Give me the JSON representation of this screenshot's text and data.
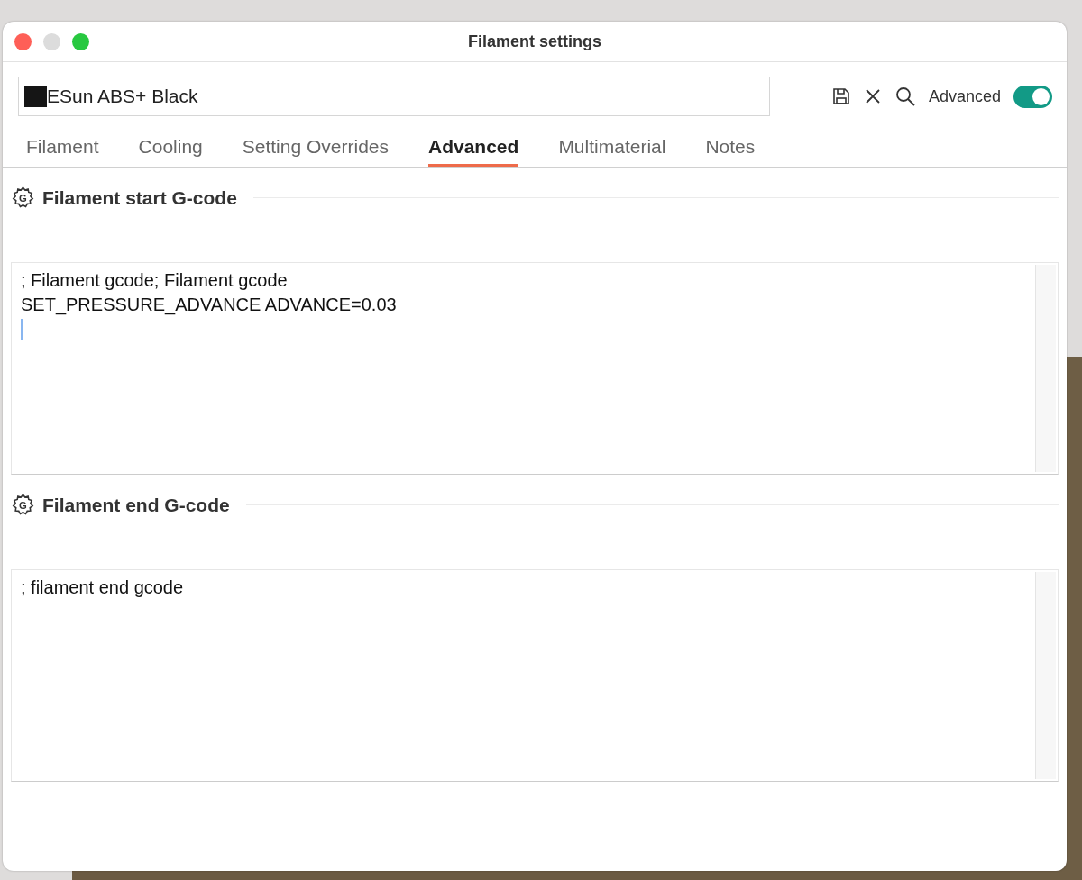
{
  "window": {
    "title": "Filament settings"
  },
  "preset": {
    "name": "ESun ABS+ Black"
  },
  "toolbar": {
    "advanced_label": "Advanced",
    "advanced_on": true
  },
  "tabs": [
    {
      "label": "Filament",
      "selected": false
    },
    {
      "label": "Cooling",
      "selected": false
    },
    {
      "label": "Setting Overrides",
      "selected": false
    },
    {
      "label": "Advanced",
      "selected": true
    },
    {
      "label": "Multimaterial",
      "selected": false
    },
    {
      "label": "Notes",
      "selected": false
    }
  ],
  "sections": [
    {
      "icon_letter": "G",
      "title": "Filament start G-code",
      "text": "; Filament gcode; Filament gcode\nSET_PRESSURE_ADVANCE ADVANCE=0.03",
      "focused": true
    },
    {
      "icon_letter": "G",
      "title": "Filament end G-code",
      "text": "; filament end gcode",
      "focused": false
    }
  ]
}
